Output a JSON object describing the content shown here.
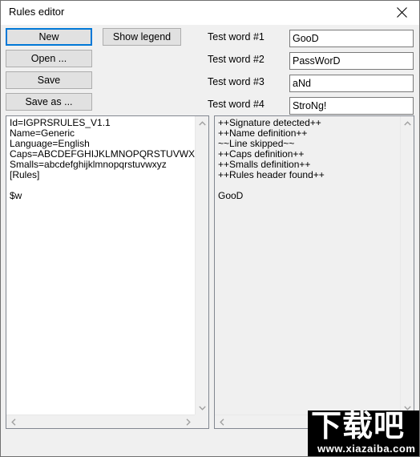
{
  "window": {
    "title": "Rules editor",
    "close_icon": "close-icon"
  },
  "toolbar": {
    "new_label": "New",
    "open_label": "Open ...",
    "save_label": "Save",
    "save_as_label": "Save as ...",
    "show_legend_label": "Show legend"
  },
  "test_words": [
    {
      "label": "Test word #1",
      "value": "GooD"
    },
    {
      "label": "Test word #2",
      "value": "PassWorD"
    },
    {
      "label": "Test word #3",
      "value": "aNd"
    },
    {
      "label": "Test word #4",
      "value": "StroNg!"
    }
  ],
  "rules_editor": {
    "content": "Id=IGPRSRULES_V1.1\nName=Generic\nLanguage=English\nCaps=ABCDEFGHIJKLMNOPQRSTUVWXYZ\nSmalls=abcdefghijklmnopqrstuvwxyz\n[Rules]\n\n$w"
  },
  "output_log": {
    "content": "++Signature detected++\n++Name definition++\n~~Line skipped~~\n++Caps definition++\n++Smalls definition++\n++Rules header found++\n\nGooD"
  },
  "scrollbars": {
    "up_icon": "chevron-up-icon",
    "down_icon": "chevron-down-icon",
    "left_icon": "chevron-left-icon",
    "right_icon": "chevron-right-icon"
  },
  "watermark": {
    "chinese": "下载吧",
    "url": "www.xiazaiba.com"
  },
  "colors": {
    "accent": "#0078d7",
    "button_face": "#e1e1e1",
    "button_border": "#adadad",
    "dialog_background": "#f0f0f0",
    "field_background": "#ffffff",
    "field_border": "#7a7a7a",
    "panel_border": "#828790",
    "text": "#000000",
    "window_border": "#707070"
  }
}
